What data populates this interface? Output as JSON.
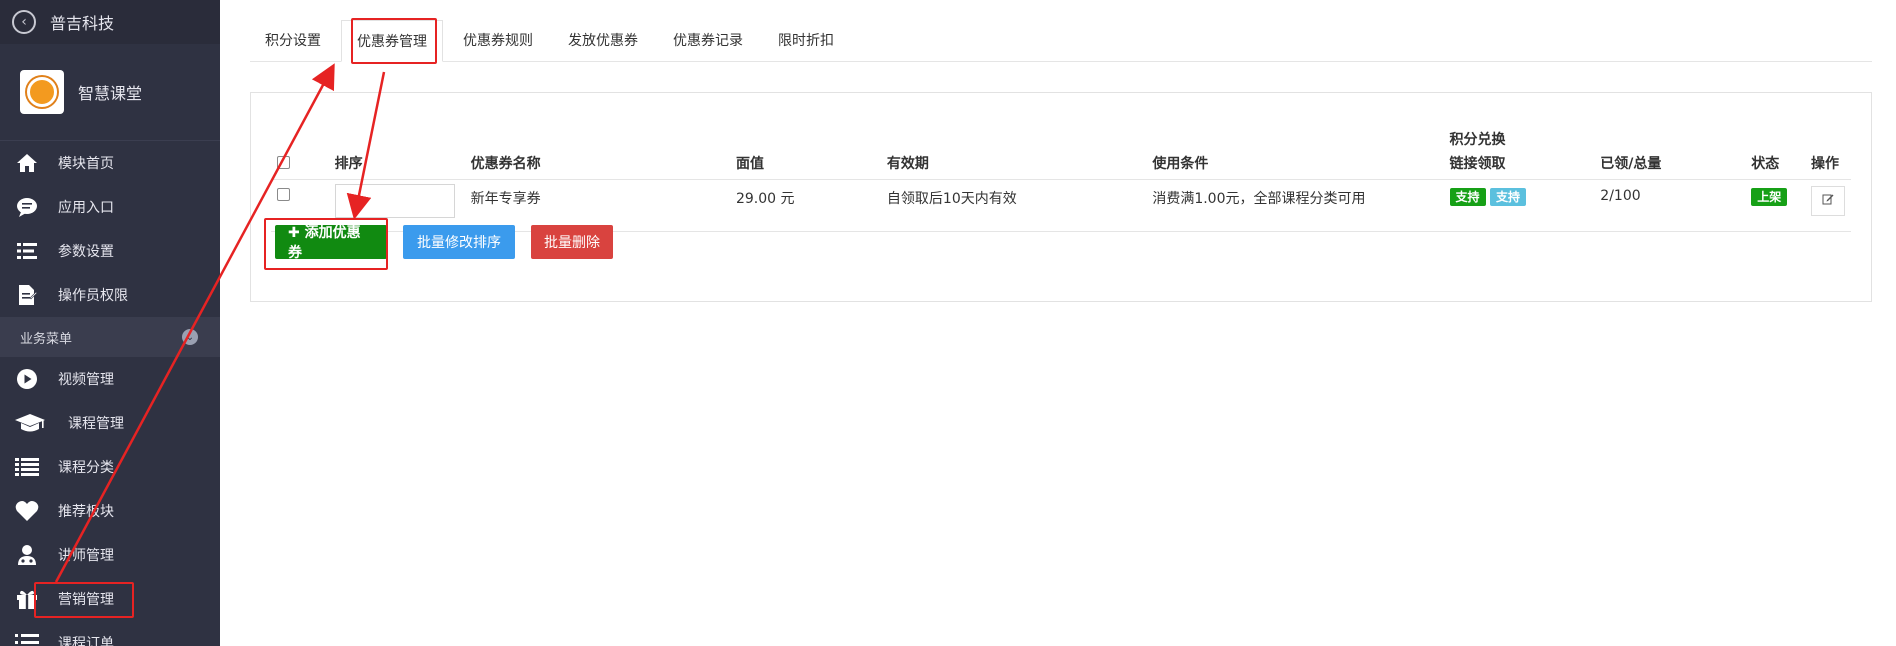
{
  "sidebar": {
    "org_name": "普吉科技",
    "app_name": "智慧课堂",
    "top_items": [
      {
        "label": "模块首页",
        "icon": "home-icon"
      },
      {
        "label": "应用入口",
        "icon": "chat-bubble-icon"
      },
      {
        "label": "参数设置",
        "icon": "list-settings-icon"
      },
      {
        "label": "操作员权限",
        "icon": "document-edit-icon"
      }
    ],
    "section_label": "业务菜单",
    "business_items": [
      {
        "label": "视频管理",
        "icon": "play-circle-icon"
      },
      {
        "label": "课程管理",
        "icon": "graduation-cap-icon"
      },
      {
        "label": "课程分类",
        "icon": "list-icon"
      },
      {
        "label": "推荐板块",
        "icon": "heart-icon"
      },
      {
        "label": "讲师管理",
        "icon": "doctor-icon"
      },
      {
        "label": "营销管理",
        "icon": "gift-icon"
      },
      {
        "label": "课程订单",
        "icon": "ordered-list-icon"
      }
    ]
  },
  "tabs": [
    {
      "label": "积分设置",
      "active": false
    },
    {
      "label": "优惠券管理",
      "active": true
    },
    {
      "label": "优惠券规则",
      "active": false
    },
    {
      "label": "发放优惠券",
      "active": false
    },
    {
      "label": "优惠券记录",
      "active": false
    },
    {
      "label": "限时折扣",
      "active": false
    }
  ],
  "table": {
    "headers": {
      "sort": "排序",
      "name": "优惠券名称",
      "value": "面值",
      "validity": "有效期",
      "condition": "使用条件",
      "points_line1": "积分兑换",
      "points_line2": "链接领取",
      "claimed": "已领/总量",
      "status": "状态",
      "action": "操作"
    },
    "rows": [
      {
        "sort": "",
        "name": "新年专享券",
        "value": "29.00 元",
        "validity": "自领取后10天内有效",
        "condition": "消费满1.00元，全部课程分类可用",
        "points_badge": "支持",
        "link_badge": "支持",
        "claimed": "2/100",
        "status": "上架"
      }
    ]
  },
  "buttons": {
    "add": "✚ 添加优惠券",
    "batch_sort": "批量修改排序",
    "batch_delete": "批量删除"
  },
  "colors": {
    "sidebar_bg": "#2f3242",
    "green": "#118a11",
    "blue": "#3b9bed",
    "red": "#d9433f",
    "teal": "#5bc0de",
    "annotation": "#e62323"
  }
}
